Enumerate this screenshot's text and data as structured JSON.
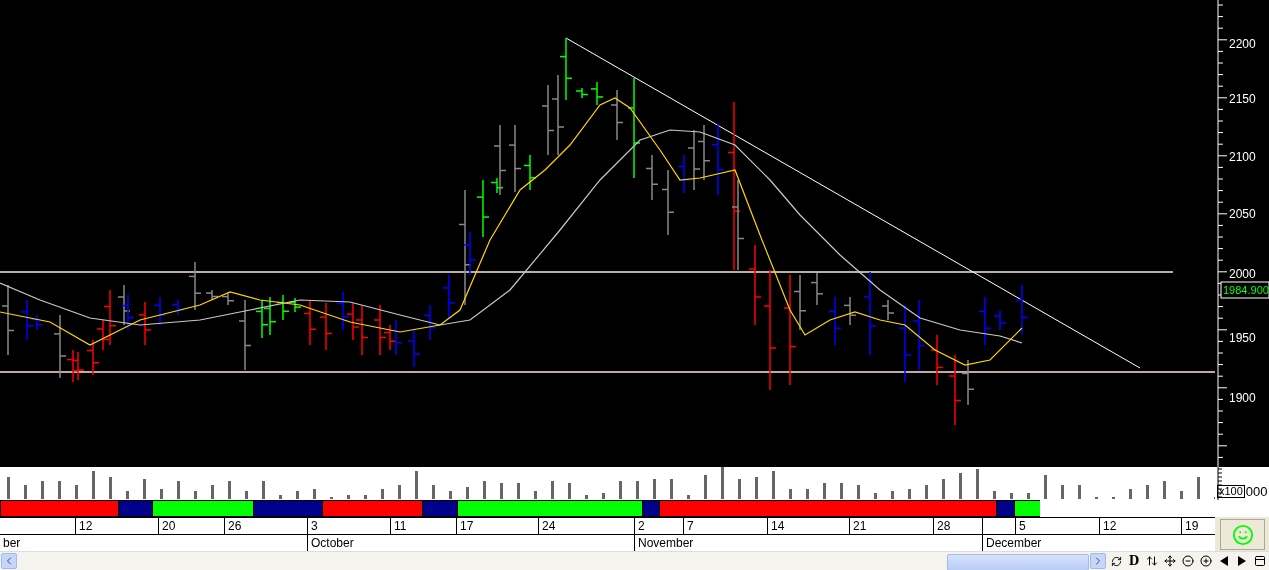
{
  "price_axis": {
    "labels": [
      "2200",
      "2150",
      "2100",
      "2050",
      "2000",
      "1950",
      "1900"
    ],
    "last_price": "1984.900"
  },
  "volume_axis": {
    "unit": "x100",
    "suffix": "000"
  },
  "date_axis": {
    "days": [
      "12",
      "20",
      "26",
      "3",
      "11",
      "17",
      "24",
      "2",
      "7",
      "14",
      "21",
      "28",
      "5",
      "12",
      "19"
    ],
    "months": [
      "ber",
      "October",
      "November",
      "December"
    ]
  },
  "toolbar": {
    "letter_button": "D"
  }
}
